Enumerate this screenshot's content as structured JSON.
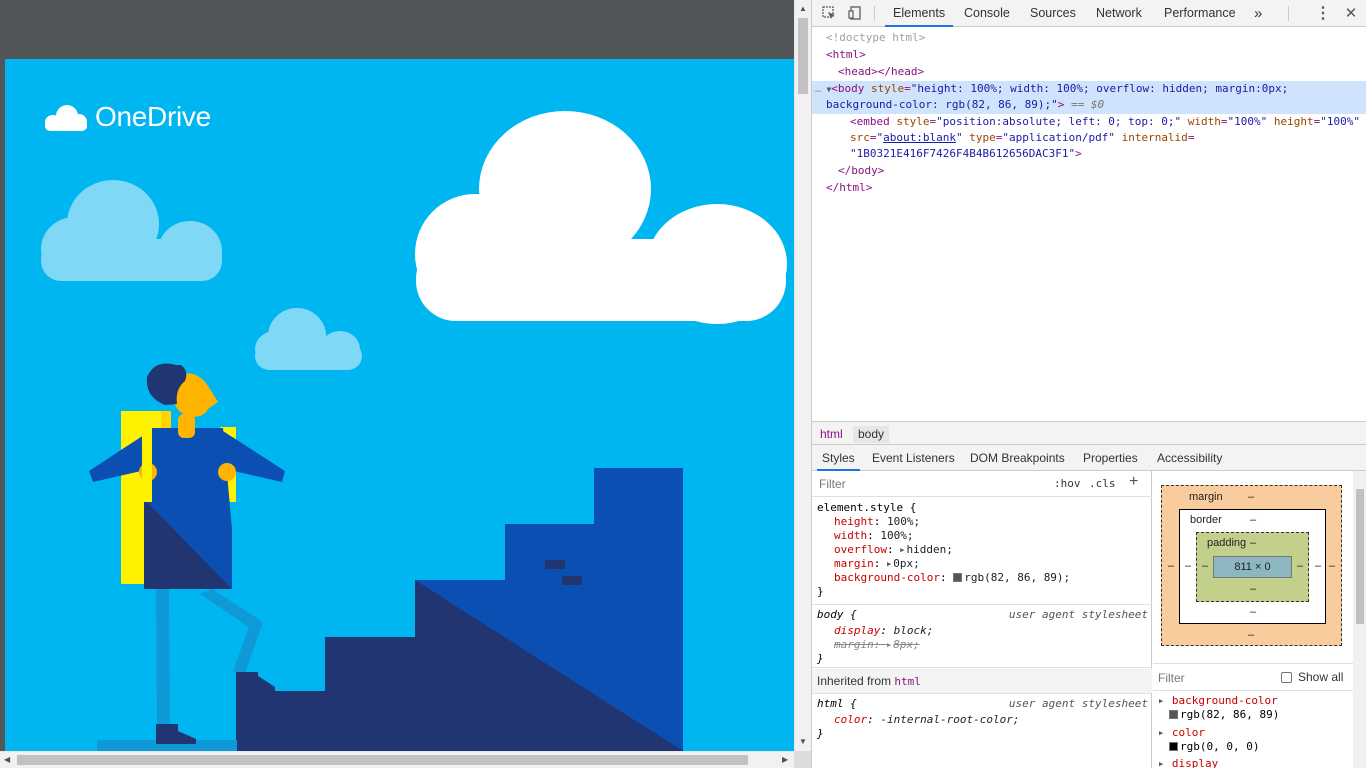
{
  "viewer": {
    "brand": "OneDrive"
  },
  "devtools": {
    "tabs": [
      "Elements",
      "Console",
      "Sources",
      "Network",
      "Performance"
    ],
    "more_tabs": "»",
    "dom": {
      "doctype": "<!doctype html>",
      "html_open": "<html>",
      "head": "<head></head>",
      "body_tag": "body",
      "body_style_attr": "style",
      "body_style_val": "\"height: 100%; width: 100%; overflow: hidden; margin:0px;",
      "body_style_val2": "background-color: rgb(82, 86, 89);\"",
      "body_suffix": "== $0",
      "embed_tag": "embed",
      "embed_style_attr": "style",
      "embed_style_val": "\"position:absolute; left: 0; top: 0;\"",
      "embed_width_attr": "width",
      "embed_width_val": "\"100%\"",
      "embed_height_attr": "height",
      "embed_height_val": "\"100%\"",
      "embed_src_attr": "src",
      "embed_src_val": "about:blank",
      "embed_type_attr": "type",
      "embed_type_val": "\"application/pdf\"",
      "embed_internalid_attr": "internalid",
      "embed_internalid_val": "\"1B0321E416F7426F4B4B612656DAC3F1\"",
      "body_close": "</body>",
      "html_close": "</html>"
    },
    "breadcrumbs": [
      "html",
      "body"
    ],
    "subtabs": [
      "Styles",
      "Event Listeners",
      "DOM Breakpoints",
      "Properties",
      "Accessibility"
    ],
    "styles": {
      "filter_placeholder": "Filter",
      "hov": ":hov",
      "cls": ".cls",
      "plus": "+",
      "element_style_selector": "element.style {",
      "element_style": [
        {
          "prop": "height",
          "value": "100%;"
        },
        {
          "prop": "width",
          "value": "100%;"
        },
        {
          "prop": "overflow",
          "value": "hidden;"
        },
        {
          "prop": "margin",
          "value": "0px;"
        },
        {
          "prop": "background-color",
          "value": "rgb(82, 86, 89);"
        }
      ],
      "close_brace": "}",
      "body_selector": "body {",
      "ua_label": "user agent stylesheet",
      "body_rules": [
        {
          "prop": "display",
          "value": "block;"
        },
        {
          "prop": "margin",
          "value": "8px;"
        }
      ],
      "inherited_label": "Inherited from",
      "inherited_from": "html",
      "html_selector": "html {",
      "html_rules": [
        {
          "prop": "color",
          "value": "-internal-root-color;"
        }
      ],
      "swatch_color": "#525659"
    },
    "boxmodel": {
      "margin_label": "margin",
      "border_label": "border",
      "padding_label": "padding",
      "dash": "–",
      "content_size": "811 × 0"
    },
    "computed": {
      "filter_placeholder": "Filter",
      "show_all": "Show all",
      "props": [
        {
          "name": "background-color",
          "value": "rgb(82, 86, 89)",
          "swatch": "#525659"
        },
        {
          "name": "color",
          "value": "rgb(0, 0, 0)",
          "swatch": "#000000"
        },
        {
          "name": "display",
          "value": ""
        }
      ]
    }
  },
  "colors": {
    "pdf_background": "#00b6f0",
    "devtools_accent": "#1a73e8"
  }
}
